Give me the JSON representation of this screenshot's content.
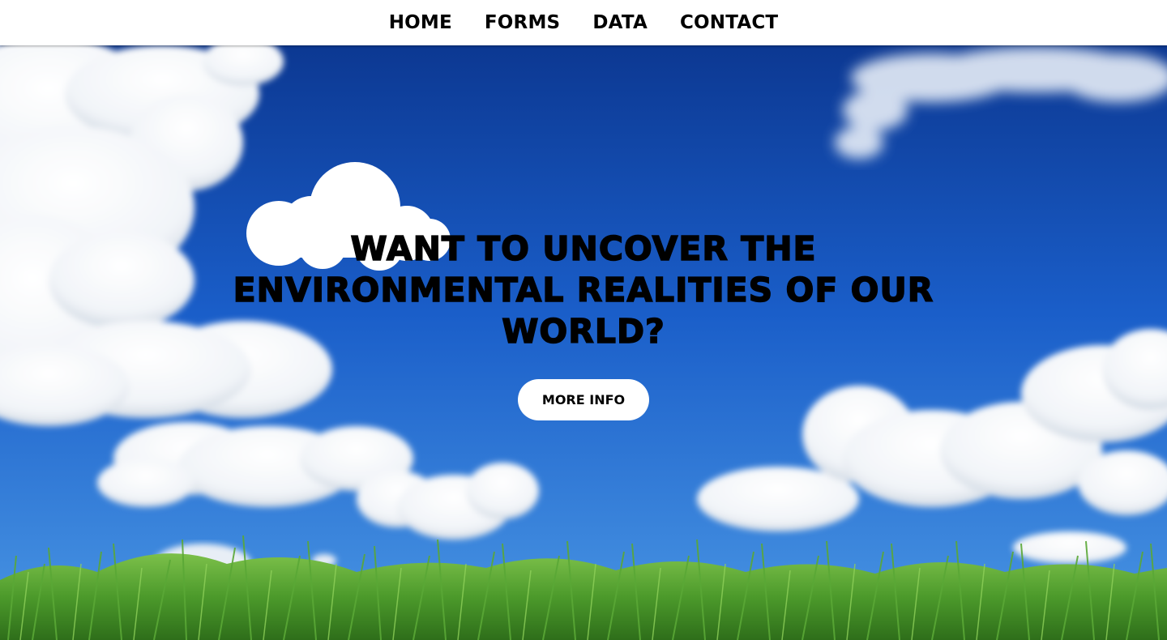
{
  "nav": {
    "items": [
      {
        "label": "HOME"
      },
      {
        "label": "FORMS"
      },
      {
        "label": "DATA"
      },
      {
        "label": "CONTACT"
      }
    ]
  },
  "hero": {
    "heading": "WANT TO UNCOVER THE ENVIRONMENTAL REALITIES OF OUR WORLD?",
    "button_label": "MORE INFO",
    "logo_icon": "cloud-icon",
    "background": "blue-sky-clouds-grass"
  },
  "colors": {
    "sky_top": "#0d3a94",
    "sky_bottom": "#3f8fe0",
    "grass": "#4f9a2e",
    "nav_bg": "#ffffff",
    "text": "#000000",
    "button_bg": "#ffffff"
  }
}
